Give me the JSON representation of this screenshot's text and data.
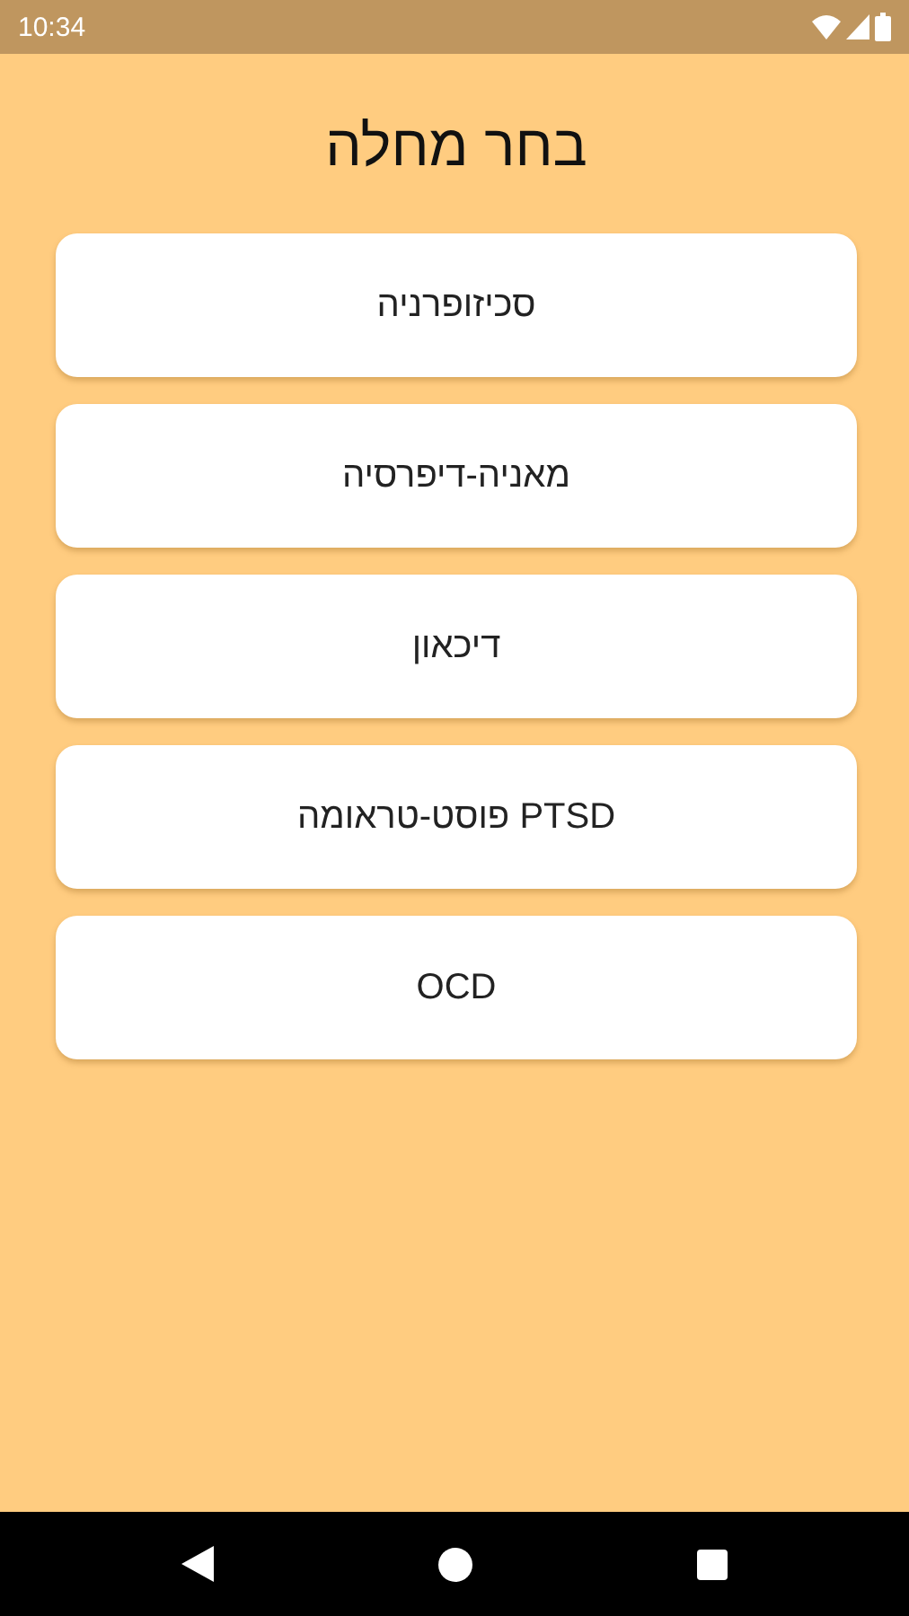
{
  "status_bar": {
    "time": "10:34"
  },
  "title": "בחר מחלה",
  "diseases": [
    {
      "label": "סכיזופרניה"
    },
    {
      "label": "מאניה-דיפרסיה"
    },
    {
      "label": "דיכאון"
    },
    {
      "label": "PTSD פוסט-טראומה"
    },
    {
      "label": "OCD"
    }
  ]
}
